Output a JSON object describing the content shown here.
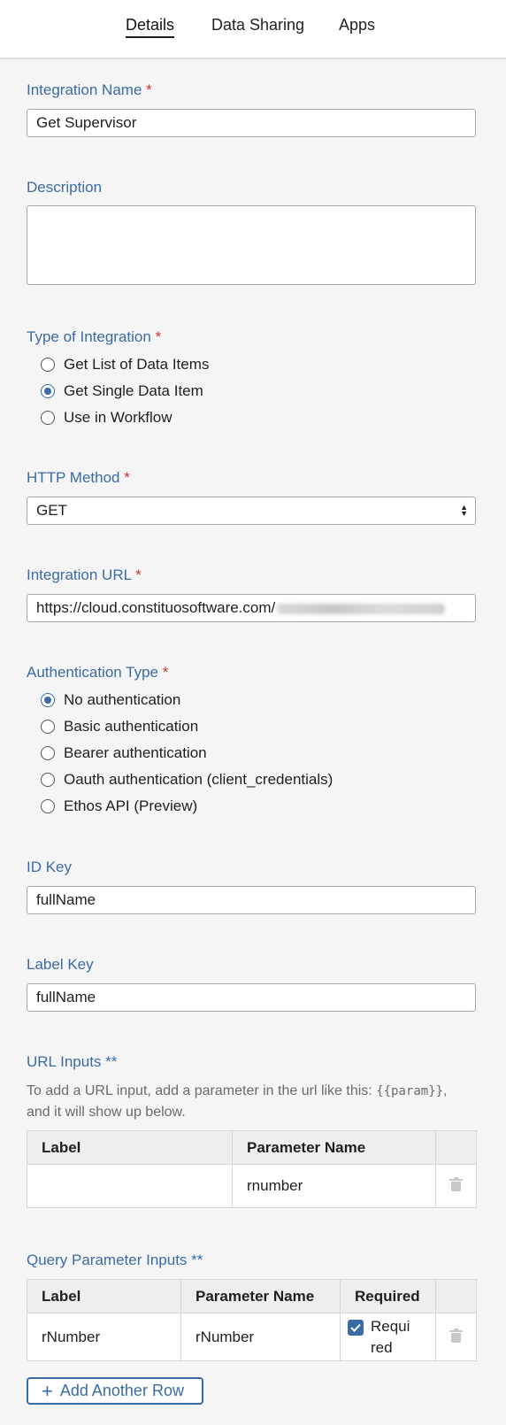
{
  "tabs": [
    {
      "label": "Details",
      "active": true
    },
    {
      "label": "Data Sharing",
      "active": false
    },
    {
      "label": "Apps",
      "active": false
    }
  ],
  "integration_name": {
    "label": "Integration Name",
    "required_mark": "*",
    "value": "Get Supervisor"
  },
  "description": {
    "label": "Description",
    "value": ""
  },
  "type_of_integration": {
    "label": "Type of Integration",
    "required_mark": "*",
    "options": [
      {
        "label": "Get List of Data Items",
        "selected": false
      },
      {
        "label": "Get Single Data Item",
        "selected": true
      },
      {
        "label": "Use in Workflow",
        "selected": false
      }
    ]
  },
  "http_method": {
    "label": "HTTP Method",
    "required_mark": "*",
    "value": "GET"
  },
  "integration_url": {
    "label": "Integration URL",
    "required_mark": "*",
    "value": "https://cloud.constituosoftware.com/"
  },
  "authentication_type": {
    "label": "Authentication Type",
    "required_mark": "*",
    "options": [
      {
        "label": "No authentication",
        "selected": true
      },
      {
        "label": "Basic authentication",
        "selected": false
      },
      {
        "label": "Bearer authentication",
        "selected": false
      },
      {
        "label": "Oauth authentication (client_credentials)",
        "selected": false
      },
      {
        "label": "Ethos API (Preview)",
        "selected": false
      }
    ]
  },
  "id_key": {
    "label": "ID Key",
    "value": "fullName"
  },
  "label_key": {
    "label": "Label Key",
    "value": "fullName"
  },
  "url_inputs": {
    "label": "URL Inputs **",
    "help_before": "To add a URL input, add a parameter in the url like this: ",
    "help_code": "{{param}}",
    "help_after": ", and it will show up below.",
    "columns": [
      "Label",
      "Parameter Name"
    ],
    "rows": [
      {
        "label": "",
        "parameter_name": "rnumber"
      }
    ]
  },
  "query_parameter_inputs": {
    "label": "Query Parameter Inputs **",
    "columns": [
      "Label",
      "Parameter Name",
      "Required"
    ],
    "rows": [
      {
        "label": "rNumber",
        "parameter_name": "rNumber",
        "required": true,
        "required_label": "Required"
      }
    ]
  },
  "add_row_button": {
    "label": "Add Another Row"
  },
  "colors": {
    "accent": "#3b6ba5",
    "required": "#d0312d",
    "background": "#f5f5f5"
  }
}
